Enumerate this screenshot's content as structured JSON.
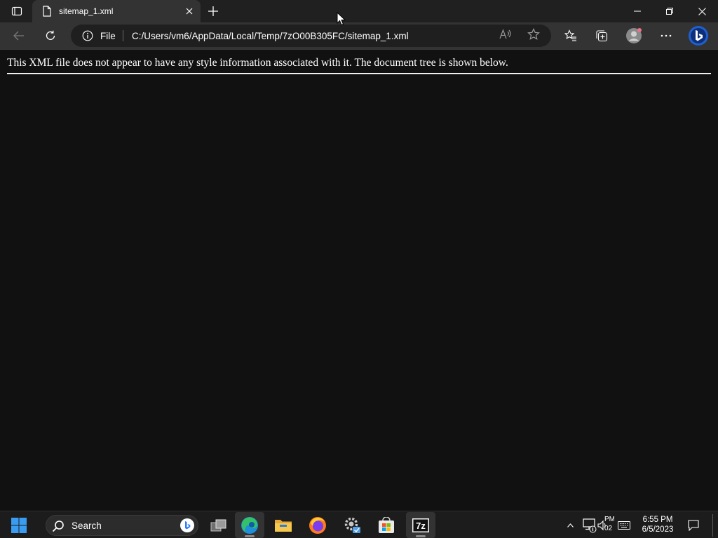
{
  "browser": {
    "tab": {
      "title": "sitemap_1.xml"
    },
    "address": {
      "scheme_label": "File",
      "url": "C:/Users/vm6/AppData/Local/Temp/7zO00B305FC/sitemap_1.xml"
    },
    "colors": {
      "accent": "#0078d4",
      "bing": "#2f7df6"
    }
  },
  "page": {
    "xml_notice": "This XML file does not appear to have any style information associated with it. The document tree is shown below."
  },
  "taskbar": {
    "search_label": "Search",
    "tray_clip_top": "PM",
    "tray_clip_bottom": "02",
    "clock_time": "6:55 PM",
    "clock_date": "6/5/2023",
    "apps": [
      "start",
      "search",
      "task-view",
      "edge",
      "file-explorer",
      "firefox",
      "settings",
      "store",
      "7zip"
    ]
  }
}
